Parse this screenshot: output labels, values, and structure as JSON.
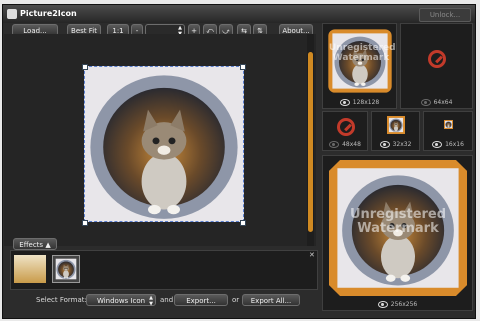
{
  "window": {
    "title": "Picture2Icon",
    "unlock_label": "Unlock..."
  },
  "toolbar": {
    "load_label": "Load...",
    "best_fit_label": "Best Fit",
    "one_to_one_label": "1:1",
    "zoom_out_label": "-",
    "zoom_in_label": "+",
    "about_label": "About..."
  },
  "effects": {
    "label": "Effects"
  },
  "format": {
    "select_label": "Select Format:",
    "selected": "Windows Icon",
    "and_label": "and",
    "export_label": "Export...",
    "or_label": "or",
    "export_all_label": "Export All..."
  },
  "previews": {
    "watermark": "Unregistered Watermark",
    "size_128": "128x128",
    "size_64": "64x64",
    "size_48": "48x48",
    "size_32": "32x32",
    "size_16": "16x16",
    "size_256": "256x256"
  },
  "colors": {
    "accent": "#d98b2b",
    "stop_red": "#c23a2a"
  }
}
